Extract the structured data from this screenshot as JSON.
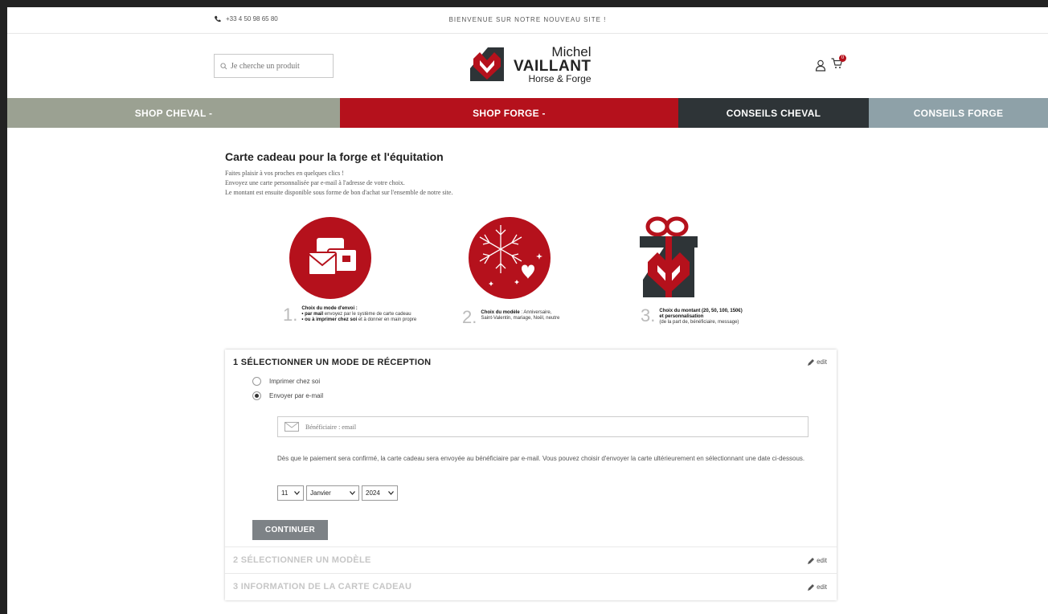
{
  "topbar": {
    "phone": "+33 4 50 98 65 80",
    "welcome": "BIENVENUE SUR NOTRE NOUVEAU SITE !"
  },
  "header": {
    "search_placeholder": "Je cherche un produit",
    "logo_line1": "Michel",
    "logo_line2": "VAILLANT",
    "logo_line3": "Horse & Forge",
    "cart_count": "0"
  },
  "nav": {
    "items": [
      {
        "label": "SHOP CHEVAL -"
      },
      {
        "label": "SHOP FORGE -"
      },
      {
        "label": "CONSEILS CHEVAL"
      },
      {
        "label": "CONSEILS FORGE"
      }
    ]
  },
  "intro": {
    "title": "Carte cadeau pour la forge et l'équitation",
    "line1": "Faites plaisir à vos proches en quelques clics !",
    "line2": "Envoyez une carte personnalisée par e-mail à l'adresse de votre choix.",
    "line3": "Le montant est ensuite disponible sous forme de bon d'achat sur l'ensemble de notre site."
  },
  "steps": [
    {
      "num": "1.",
      "heading": "Choix du mode d'envoi :",
      "sub1_bold": "• par mail",
      "sub1": " envoyez par le système de carte cadeau",
      "sub2_bold": "• ou à imprimer chez soi",
      "sub2": " et à donner en main propre"
    },
    {
      "num": "2.",
      "heading": "Choix du modèle",
      "text1": " : Anniversaire,",
      "text2": "Saint-Valentin, mariage, Noël, neutre"
    },
    {
      "num": "3.",
      "heading": "Choix du montant (20, 50, 100, 150€)",
      "heading2": "et personnalisation",
      "text": "(de la part de, bénéficiaire, message)"
    }
  ],
  "section1": {
    "title": "1 SÉLECTIONNER UN MODE DE RÉCEPTION",
    "edit": "edit",
    "option1": "Imprimer chez soi",
    "option2": "Envoyer par e-mail",
    "selected": "option2",
    "email_placeholder": "Bénéficiaire : email",
    "note": "Dès que le paiement sera confirmé, la carte cadeau sera envoyée au bénéficiaire par e-mail. Vous pouvez choisir d'envoyer la carte ultérieurement en sélectionnant une date ci-dessous.",
    "day": "11",
    "month": "Janvier",
    "year": "2024",
    "continue": "CONTINUER"
  },
  "section2": {
    "title": "2 SÉLECTIONNER UN MODÈLE",
    "edit": "edit"
  },
  "section3": {
    "title": "3 INFORMATION DE LA CARTE CADEAU",
    "edit": "edit"
  },
  "colors": {
    "red": "#b5111c",
    "sage": "#9ba192",
    "dark": "#2e3437",
    "steel": "#8ea1a8"
  }
}
